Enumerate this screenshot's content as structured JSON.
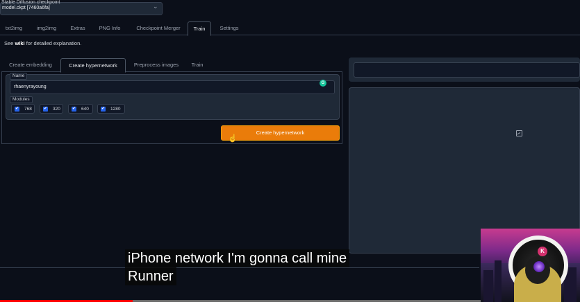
{
  "checkpoint": {
    "label": "Stable Diffusion checkpoint",
    "value": "model.ckpt [7460a6fa]",
    "chevron_icon": "chevron-down-icon"
  },
  "main_tabs": [
    "txt2img",
    "img2img",
    "Extras",
    "PNG Info",
    "Checkpoint Merger",
    "Train",
    "Settings"
  ],
  "main_tab_active": "Train",
  "wiki": {
    "prefix": "See ",
    "link": "wiki",
    "suffix": " for detailed explanation."
  },
  "sub_tabs": [
    "Create embedding",
    "Create hypernetwork",
    "Preprocess images",
    "Train"
  ],
  "sub_tab_active": "Create hypernetwork",
  "form": {
    "name_label": "Name",
    "name_value": "rhaenyrayoung",
    "grammarly_icon": "G",
    "modules_label": "Modules",
    "modules": [
      {
        "label": "768",
        "checked": true
      },
      {
        "label": "320",
        "checked": true
      },
      {
        "label": "640",
        "checked": true
      },
      {
        "label": "1280",
        "checked": true
      }
    ],
    "create_button": "Create hypernetwork",
    "checkmark": "✔"
  },
  "gallery": {
    "icon": "image-icon"
  },
  "captions": {
    "line1": "iPhone network I'm gonna call mine",
    "line2": "Runner"
  },
  "webcam": {
    "badge": "K"
  },
  "video": {
    "progress": 0.276
  },
  "colors": {
    "accent": "#ea7c0a",
    "checkbox": "#2563eb",
    "background": "#0b0f19",
    "progress": "#ff0000"
  }
}
